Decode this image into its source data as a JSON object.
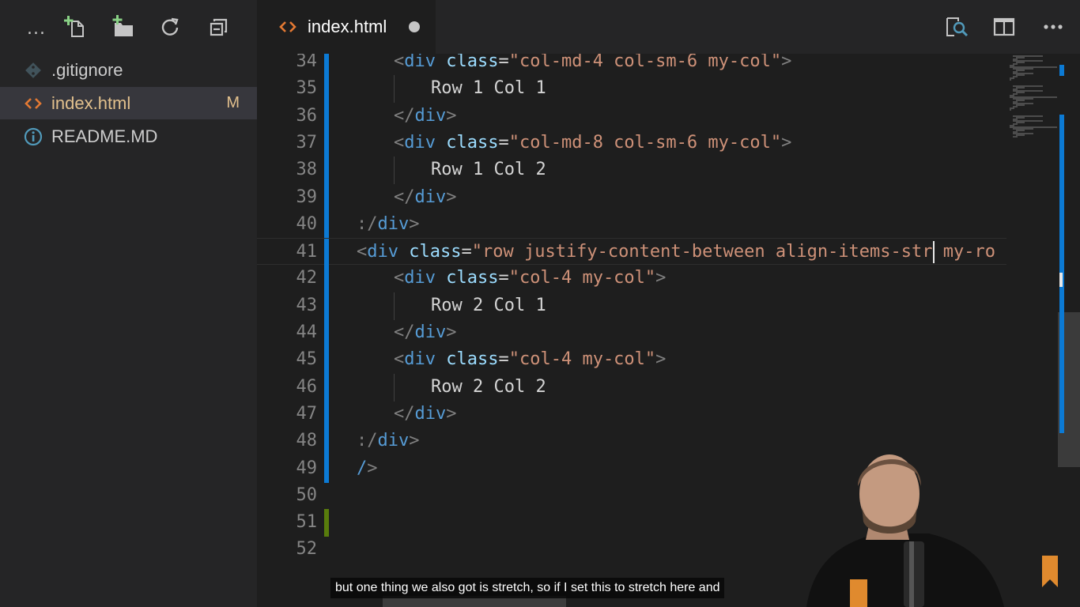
{
  "sidebar": {
    "toolbar": [
      {
        "name": "more-actions",
        "label": "..."
      },
      {
        "name": "new-file-icon"
      },
      {
        "name": "new-folder-icon"
      },
      {
        "name": "refresh-icon"
      },
      {
        "name": "collapse-all-icon"
      }
    ],
    "files": [
      {
        "name": ".gitignore",
        "icon": "git-icon",
        "icon_color": "#41535b",
        "badge": ""
      },
      {
        "name": "index.html",
        "icon": "html-icon",
        "icon_color": "#e37933",
        "badge": "M",
        "active": true
      },
      {
        "name": "README.MD",
        "icon": "info-icon",
        "icon_color": "#519aba",
        "badge": ""
      }
    ]
  },
  "tab": {
    "label": "index.html",
    "icon": "html-icon",
    "dirty": true
  },
  "tab_actions": [
    "open-preview-icon",
    "split-editor-icon",
    "more-actions-icon"
  ],
  "editor": {
    "lines": [
      {
        "n": "34",
        "indent": 1,
        "tokens": [
          [
            "punc",
            "<"
          ],
          [
            "tag",
            "div"
          ],
          [
            "text",
            " "
          ],
          [
            "attr",
            "class"
          ],
          [
            "text",
            "="
          ],
          [
            "str",
            "\"col-md-4 col-sm-6 my-col\""
          ],
          [
            "punc",
            ">"
          ]
        ]
      },
      {
        "n": "35",
        "indent": 2,
        "tokens": [
          [
            "text",
            "Row 1 Col 1"
          ]
        ]
      },
      {
        "n": "36",
        "indent": 1,
        "tokens": [
          [
            "punc",
            "</"
          ],
          [
            "tag",
            "div"
          ],
          [
            "punc",
            ">"
          ]
        ]
      },
      {
        "n": "37",
        "indent": 1,
        "tokens": [
          [
            "punc",
            "<"
          ],
          [
            "tag",
            "div"
          ],
          [
            "text",
            " "
          ],
          [
            "attr",
            "class"
          ],
          [
            "text",
            "="
          ],
          [
            "str",
            "\"col-md-8 col-sm-6 my-col\""
          ],
          [
            "punc",
            ">"
          ]
        ]
      },
      {
        "n": "38",
        "indent": 2,
        "tokens": [
          [
            "text",
            "Row 1 Col 2"
          ]
        ]
      },
      {
        "n": "39",
        "indent": 1,
        "tokens": [
          [
            "punc",
            "</"
          ],
          [
            "tag",
            "div"
          ],
          [
            "punc",
            ">"
          ]
        ]
      },
      {
        "n": "40",
        "indent": 0,
        "tokens": [
          [
            "punc",
            ":/"
          ],
          [
            "tag",
            "div"
          ],
          [
            "punc",
            ">"
          ]
        ]
      },
      {
        "n": "41",
        "indent": 0,
        "current": true,
        "tokens": [
          [
            "punc",
            "<"
          ],
          [
            "tag",
            "div"
          ],
          [
            "text",
            " "
          ],
          [
            "attr",
            "class"
          ],
          [
            "text",
            "="
          ],
          [
            "str",
            "\"row justify-content-between align-items-str"
          ],
          [
            "cursor",
            ""
          ],
          [
            "str",
            " my-ro"
          ]
        ]
      },
      {
        "n": "42",
        "indent": 1,
        "tokens": [
          [
            "punc",
            "<"
          ],
          [
            "tag",
            "div"
          ],
          [
            "text",
            " "
          ],
          [
            "attr",
            "class"
          ],
          [
            "text",
            "="
          ],
          [
            "str",
            "\"col-4 my-col\""
          ],
          [
            "punc",
            ">"
          ]
        ]
      },
      {
        "n": "43",
        "indent": 2,
        "tokens": [
          [
            "text",
            "Row 2 Col 1"
          ]
        ]
      },
      {
        "n": "44",
        "indent": 1,
        "tokens": [
          [
            "punc",
            "</"
          ],
          [
            "tag",
            "div"
          ],
          [
            "punc",
            ">"
          ]
        ]
      },
      {
        "n": "45",
        "indent": 1,
        "tokens": [
          [
            "punc",
            "<"
          ],
          [
            "tag",
            "div"
          ],
          [
            "text",
            " "
          ],
          [
            "attr",
            "class"
          ],
          [
            "text",
            "="
          ],
          [
            "str",
            "\"col-4 my-col\""
          ],
          [
            "punc",
            ">"
          ]
        ]
      },
      {
        "n": "46",
        "indent": 2,
        "tokens": [
          [
            "text",
            "Row 2 Col 2"
          ]
        ]
      },
      {
        "n": "47",
        "indent": 1,
        "tokens": [
          [
            "punc",
            "</"
          ],
          [
            "tag",
            "div"
          ],
          [
            "punc",
            ">"
          ]
        ]
      },
      {
        "n": "48",
        "indent": 0,
        "tokens": [
          [
            "punc",
            ":/"
          ],
          [
            "tag",
            "div"
          ],
          [
            "punc",
            ">"
          ]
        ]
      },
      {
        "n": "49",
        "indent": 0,
        "tokens": [
          [
            "tag",
            "/"
          ],
          [
            "punc",
            ">"
          ]
        ]
      },
      {
        "n": "50",
        "indent": 0,
        "tokens": []
      },
      {
        "n": "51",
        "indent": 0,
        "tokens": []
      },
      {
        "n": "52",
        "indent": 0,
        "tokens": []
      }
    ],
    "gutter_modified_color": "#0c7ad4",
    "gutter_added_color": "#587c0c"
  },
  "caption": "but one thing we also got is stretch, so if I set this to stretch here and",
  "colors": {
    "sidebar_bg": "#252526",
    "editor_bg": "#1e1e1e",
    "accent_orange": "#e37933",
    "modified_text": "#e2c08d"
  }
}
